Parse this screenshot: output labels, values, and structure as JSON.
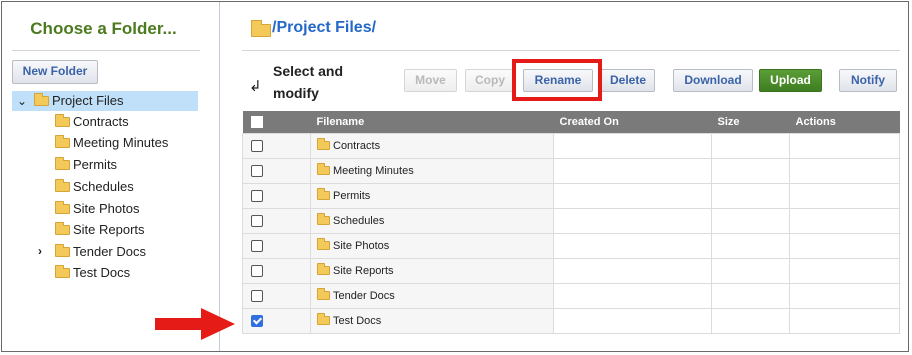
{
  "sidebar": {
    "title": "Choose a Folder...",
    "new_folder_label": "New Folder",
    "root": {
      "label": "Project Files",
      "expanded": true,
      "selected": true
    },
    "children": [
      {
        "label": "Contracts",
        "has_children": false
      },
      {
        "label": "Meeting Minutes",
        "has_children": false
      },
      {
        "label": "Permits",
        "has_children": false
      },
      {
        "label": "Schedules",
        "has_children": false
      },
      {
        "label": "Site Photos",
        "has_children": false
      },
      {
        "label": "Site Reports",
        "has_children": false
      },
      {
        "label": "Tender Docs",
        "has_children": true
      },
      {
        "label": "Test Docs",
        "has_children": false
      }
    ]
  },
  "header": {
    "path": "/Project Files/",
    "select_label": "Select and modify"
  },
  "toolbar": {
    "move_label": "Move",
    "copy_label": "Copy",
    "rename_label": "Rename",
    "delete_label": "Delete",
    "download_label": "Download",
    "upload_label": "Upload",
    "notify_label": "Notify"
  },
  "table": {
    "columns": [
      "Filename",
      "Created On",
      "Size",
      "Actions"
    ],
    "rows": [
      {
        "name": "Contracts",
        "checked": false
      },
      {
        "name": "Meeting Minutes",
        "checked": false
      },
      {
        "name": "Permits",
        "checked": false
      },
      {
        "name": "Schedules",
        "checked": false
      },
      {
        "name": "Site Photos",
        "checked": false
      },
      {
        "name": "Site Reports",
        "checked": false
      },
      {
        "name": "Tender Docs",
        "checked": false
      },
      {
        "name": "Test Docs",
        "checked": true
      }
    ]
  },
  "colors": {
    "title_green": "#4b7a1f",
    "link_blue": "#2468c8",
    "highlight_red": "#e41b17",
    "upload_green": "#4a8c2a",
    "header_gray": "#7a7a7a",
    "selection_blue": "#bfe0f8"
  }
}
